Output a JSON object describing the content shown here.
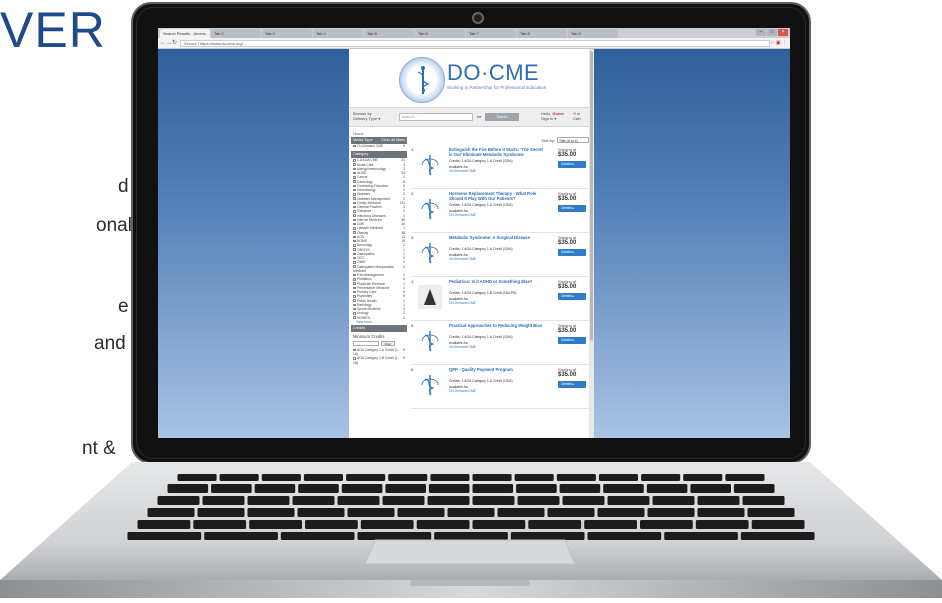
{
  "slide": {
    "heading": "VER",
    "text_lines": [
      "d",
      "onal",
      "e",
      "and",
      "nt &"
    ]
  },
  "browser": {
    "tabs": [
      "Search Results - Americ...",
      "Tab 2",
      "Tab 3",
      "Tab 4",
      "Tab 5",
      "Tab 6",
      "Tab 7",
      "Tab 8",
      "Tab 9"
    ],
    "url_secure": "Secure",
    "url": "https://www.do-cme.org/..."
  },
  "site": {
    "logo_text": "DO·CME",
    "tagline": "Working in Partnership for Professional Education",
    "browse_label": "Browse by",
    "browse_value": "Delivery Type ▾",
    "search_placeholder": "search...",
    "search_for": "for",
    "search_button": "Search",
    "hello": "Hello,",
    "guest": "Guest",
    "signin": "Sign in ▾",
    "cart_count": "0 in",
    "cart_label": "Cart",
    "breadcrumb": "Home"
  },
  "sidebar": {
    "media_type_title": "Media Type",
    "clear_all": "Clear all filters",
    "media_items": [
      {
        "label": "On-Demand CME",
        "count": "6"
      }
    ],
    "category_title": "Category",
    "categories": [
      {
        "label": "1-A AOA CME",
        "count": "31"
      },
      {
        "label": "Acute Care",
        "count": "3"
      },
      {
        "label": "Allergy/Immunology",
        "count": "2"
      },
      {
        "label": "ADHD",
        "count": "24"
      },
      {
        "label": "Cancer",
        "count": "2"
      },
      {
        "label": "Cardiology",
        "count": "8"
      },
      {
        "label": "Continuing Education",
        "count": "5"
      },
      {
        "label": "Dermatology",
        "count": "3"
      },
      {
        "label": "Diabetes",
        "count": "2"
      },
      {
        "label": "Diabetes Management",
        "count": "2"
      },
      {
        "label": "Family Medicine",
        "count": "131"
      },
      {
        "label": "General Practice",
        "count": "3"
      },
      {
        "label": "Geriatrics",
        "count": "2"
      },
      {
        "label": "Infectious Diseases",
        "count": "2"
      },
      {
        "label": "Internal Medicine",
        "count": "46"
      },
      {
        "label": "CME",
        "count": "28"
      },
      {
        "label": "Lifestyle Medicine",
        "count": "1"
      },
      {
        "label": "Obesity",
        "count": "48"
      },
      {
        "label": "AOA",
        "count": "13"
      },
      {
        "label": "NOMS",
        "count": "18"
      },
      {
        "label": "Neurology",
        "count": "2"
      },
      {
        "label": "OB/GYN",
        "count": "1"
      },
      {
        "label": "Osteopathic",
        "count": "1"
      },
      {
        "label": "OCC",
        "count": "9"
      },
      {
        "label": "OMM",
        "count": "9"
      },
      {
        "label": "Osteopathic Manipulative Medicine",
        "count": "2"
      },
      {
        "label": "Pain Management",
        "count": "2"
      },
      {
        "label": "Pediatrics",
        "count": "8"
      },
      {
        "label": "Physician Renewal",
        "count": "1"
      },
      {
        "label": "Preventative Medicine",
        "count": "1"
      },
      {
        "label": "Primary Care",
        "count": "6"
      },
      {
        "label": "Psychiatry",
        "count": "5"
      },
      {
        "label": "Public Health",
        "count": "1"
      },
      {
        "label": "Radiology",
        "count": "1"
      },
      {
        "label": "Sports Medicine",
        "count": "3"
      },
      {
        "label": "Urology",
        "count": "2"
      },
      {
        "label": "WOMEN",
        "count": "2"
      }
    ],
    "view_more": "View more...",
    "credits_title": "Credits",
    "minimum_credits": "Minimum Credits",
    "filter_button": "Filter",
    "credit_items": [
      {
        "label": "AOA Category 1-A Credit (1-1A)",
        "count": "5"
      },
      {
        "label": "AOA Category 1-B Credit (1-1B)",
        "count": "5"
      }
    ]
  },
  "results": {
    "sort_label": "Sort by:",
    "sort_value": "Title (A to Z)",
    "starting_at": "Starting at",
    "details_label": "Details",
    "available_label": "Available As:",
    "items": [
      {
        "num": "1.",
        "title": "Extinguish the Fire Before it Starts: 'The Secret is Out' Eliminate Metabolic Syndrome",
        "credits": "Credits: 1 AOA Category 1-A Credit (ODA)",
        "option": "On-Demand CME",
        "price": "$35.00"
      },
      {
        "num": "2.",
        "title": "Hormone Replacement Therapy - What Role Should It Play With Our Patients?",
        "credits": "Credits: 1 AOA Category 1-A Credit (ODA)",
        "option": "On-Demand CME",
        "price": "$35.00"
      },
      {
        "num": "3.",
        "title": "Metabolic Syndrome: A Surgical Disease",
        "credits": "Credits: 1 AOA Category 1-A Credit (ODA)",
        "option": "On-Demand CME",
        "price": "$35.00"
      },
      {
        "num": "4.",
        "title": "Pediatrics: Is it ADHD or Something Else?",
        "credits": "Credits: 1 AOA Category 1-B Credit (NALPB)",
        "option": "On-Demand CME",
        "price": "$35.00"
      },
      {
        "num": "5.",
        "title": "Practical Approaches to Reducing Weight Bias",
        "credits": "Credits: 1 AOA Category 1-A Credit (ODA)",
        "option": "On-Demand CME",
        "price": "$35.00"
      },
      {
        "num": "6.",
        "title": "QPP - Quality Payment Program",
        "credits": "Credits: 1 AOA Category 1-A Credit (ODA)",
        "option": "On-Demand CME",
        "price": "$35.00"
      }
    ]
  },
  "colors": {
    "brand": "#2a6db5",
    "guest": "#c0392b",
    "details_button": "#2e7cc6",
    "heading": "#1e4a8a"
  }
}
